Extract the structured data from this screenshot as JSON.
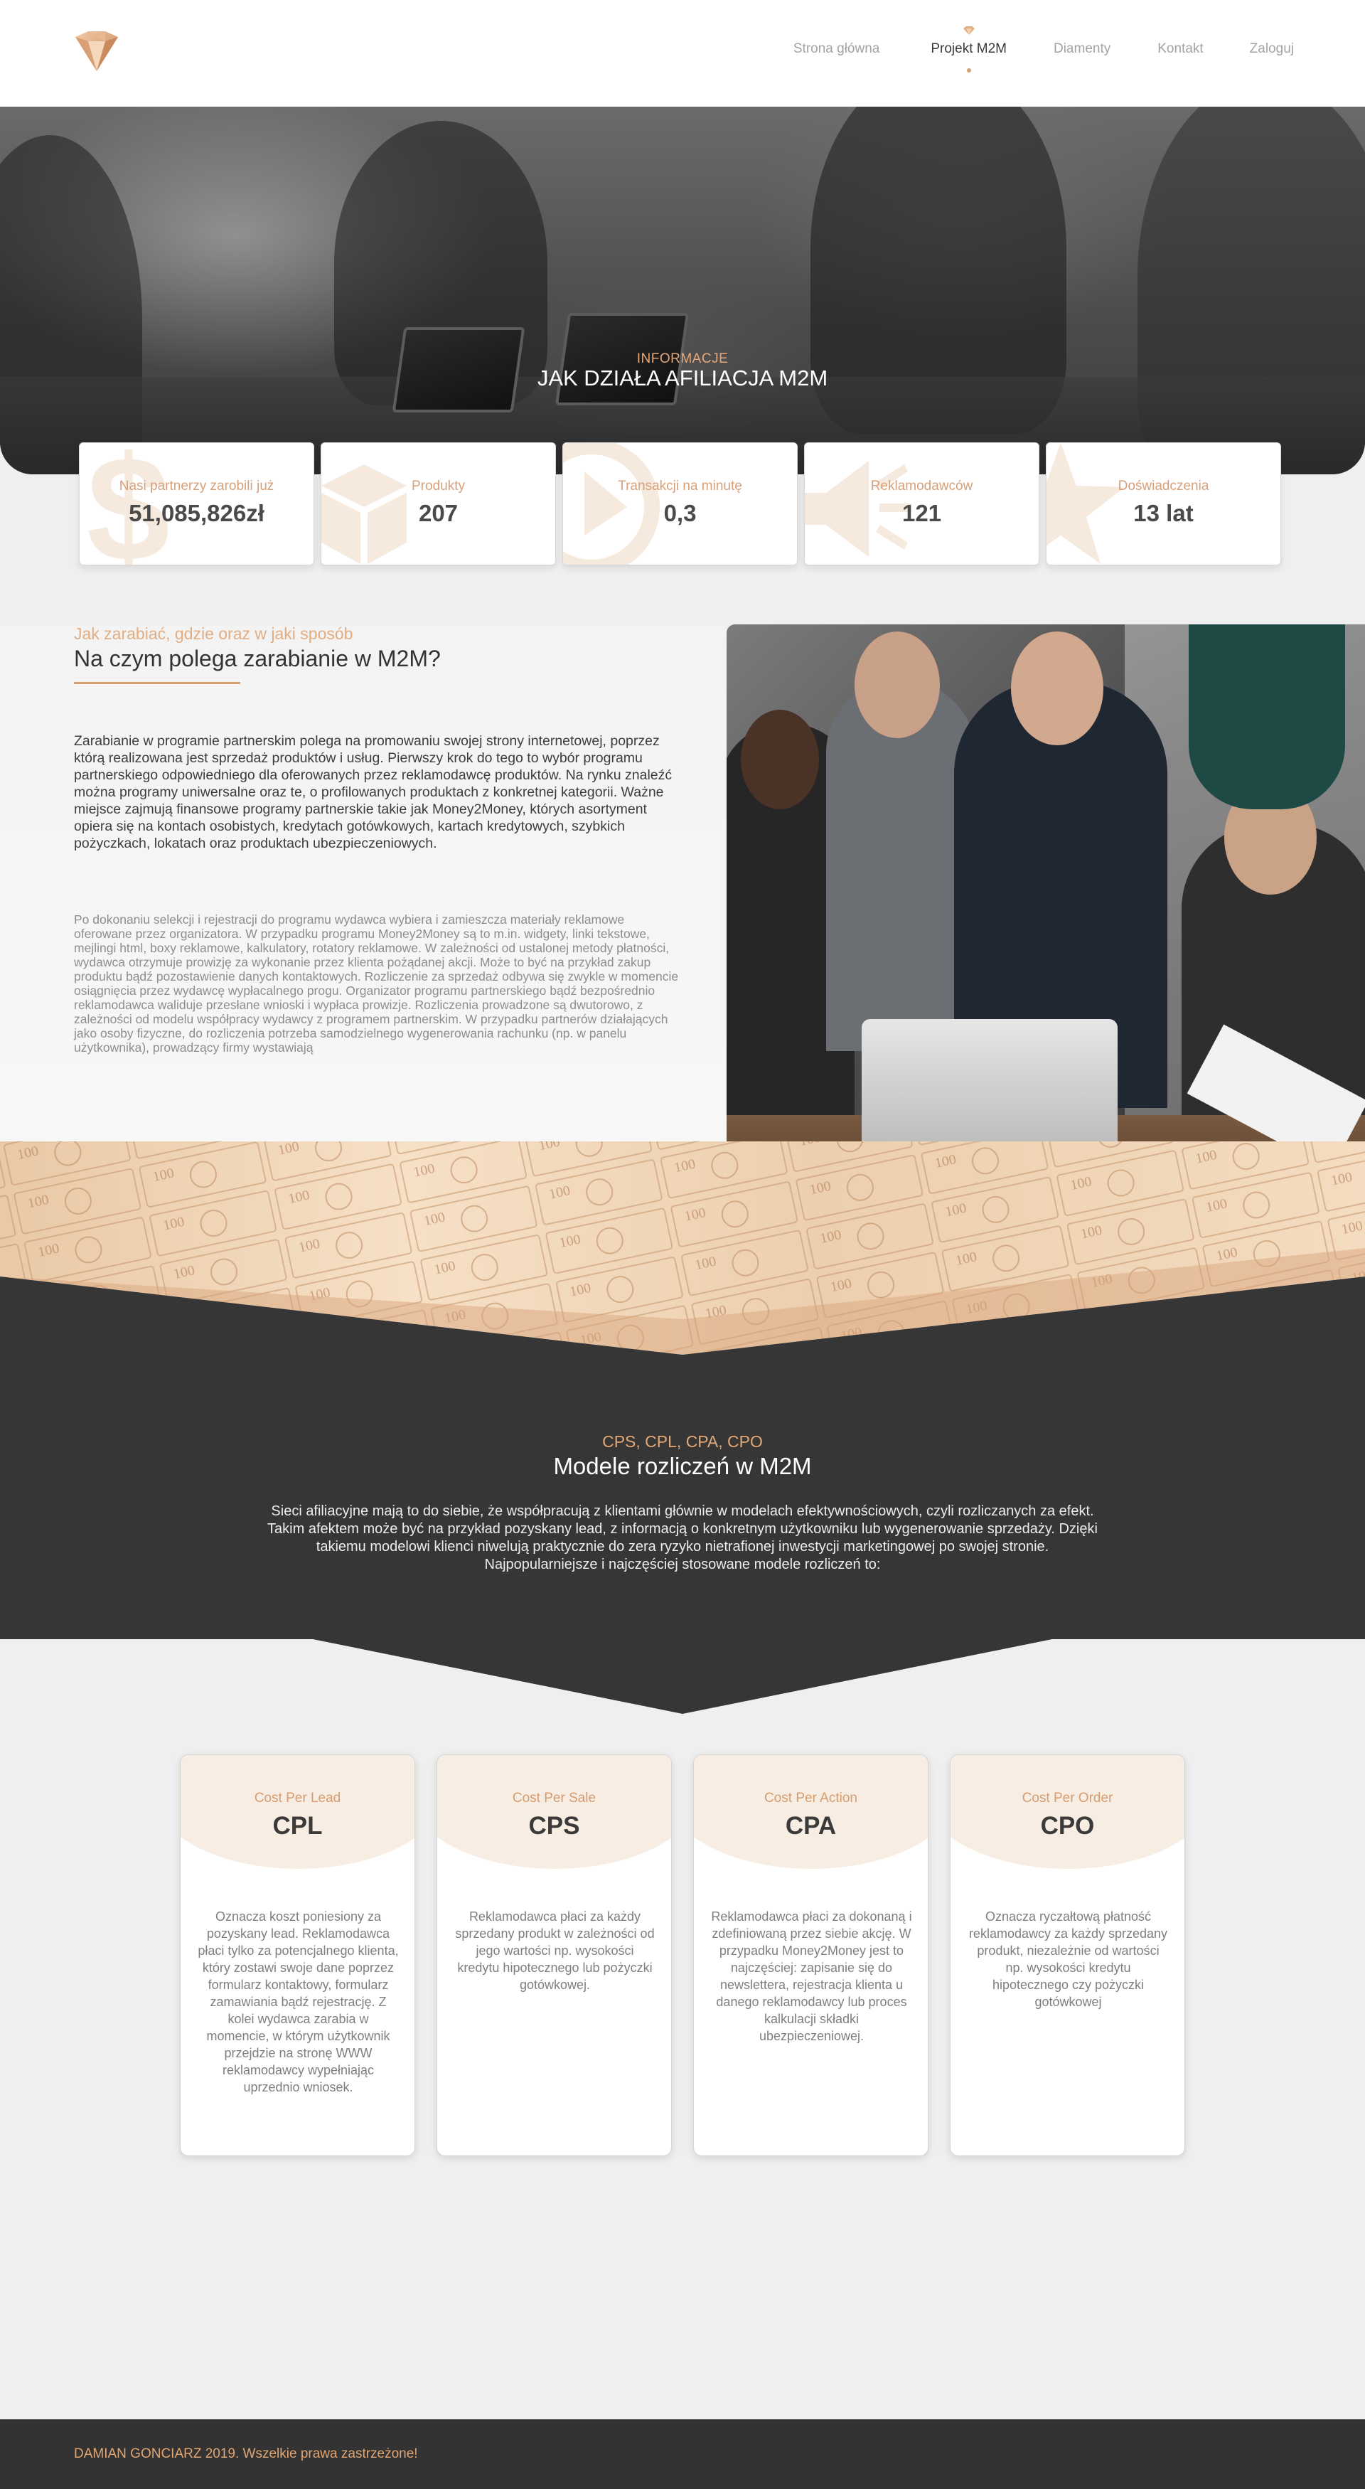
{
  "nav": {
    "items": [
      {
        "label": "Strona główna"
      },
      {
        "label": "Projekt M2M"
      },
      {
        "label": "Diamenty"
      },
      {
        "label": "Kontakt"
      },
      {
        "label": "Zaloguj"
      }
    ],
    "active_index": 1
  },
  "hero": {
    "kicker": "INFORMACJE",
    "title": "JAK DZIAŁA AFILIACJA M2M"
  },
  "stats": [
    {
      "label": "Nasi partnerzy zarobili już",
      "value": "51,085,826zł",
      "icon": "dollar-icon"
    },
    {
      "label": "Produkty",
      "value": "207",
      "icon": "box-icon"
    },
    {
      "label": "Transakcji na minutę",
      "value": "0,3",
      "icon": "clock-icon"
    },
    {
      "label": "Reklamodawców",
      "value": "121",
      "icon": "megaphone-icon"
    },
    {
      "label": "Doświadczenia",
      "value": "13 lat",
      "icon": "star-icon"
    }
  ],
  "about": {
    "kicker": "Jak zarabiać, gdzie oraz w jaki sposób",
    "title": "Na czym polega zarabianie w M2M?",
    "paragraph1": "Zarabianie w programie partnerskim polega na promowaniu swojej strony internetowej, poprzez którą realizowana jest sprzedaż produktów i usług. Pierwszy krok do tego to wybór programu partnerskiego odpowiedniego dla oferowanych przez reklamodawcę produktów. Na rynku znaleźć można programy uniwersalne oraz te, o profilowanych produktach z konkretnej kategorii. Ważne miejsce zajmują finansowe programy partnerskie takie jak Money2Money, których asortyment opiera się na kontach osobistych, kredytach gotówkowych, kartach kredytowych, szybkich pożyczkach, lokatach oraz produktach ubezpieczeniowych.",
    "paragraph2": "Po dokonaniu selekcji i rejestracji do programu wydawca wybiera i zamieszcza materiały reklamowe oferowane przez organizatora. W przypadku programu Money2Money są to m.in. widgety, linki tekstowe, mejlingi html, boxy reklamowe, kalkulatory, rotatory reklamowe. W zależności od ustalonej metody płatności, wydawca otrzymuje prowizję za wykonanie przez klienta pożądanej akcji. Może to być na przykład zakup produktu bądź pozostawienie danych kontaktowych. Rozliczenie za sprzedaż odbywa się zwykle w momencie osiągnięcia przez wydawcę wypłacalnego progu. Organizator programu partnerskiego bądź bezpośrednio reklamodawca waliduje przesłane wnioski i wypłaca prowizje. Rozliczenia prowadzone są dwutorowo, z zależności od modelu współpracy wydawcy z programem partnerskim. W przypadku partnerów działających jako osoby fizyczne, do rozliczenia potrzeba samodzielnego wygenerowania rachunku (np. w panelu użytkownika), prowadzący firmy wystawiają"
  },
  "models_section": {
    "kicker": "CPS, CPL, CPA, CPO",
    "title": "Modele rozliczeń w M2M",
    "description": "Sieci afiliacyjne mają to do siebie, że współpracują z klientami głównie w modelach efektywnościowych, czyli rozliczanych za efekt. Takim afektem może być na przykład pozyskany lead, z informacją o konkretnym użytkowniku lub wygenerowanie sprzedaży. Dzięki takiemu modelowi klienci niwelują praktycznie do zera ryzyko nietrafionej inwestycji marketingowej po swojej stronie. Najpopularniejsze i najczęściej stosowane modele rozliczeń to:"
  },
  "models": [
    {
      "subtitle": "Cost Per Lead",
      "abbr": "CPL",
      "text": "Oznacza koszt poniesiony za pozyskany lead. Reklamodawca płaci tylko za potencjalnego klienta, który zostawi swoje dane poprzez formularz kontaktowy, formularz zamawiania bądź rejestrację. Z kolei wydawca zarabia w momencie, w którym użytkownik przejdzie na stronę WWW reklamodawcy wypełniając uprzednio wniosek."
    },
    {
      "subtitle": "Cost Per Sale",
      "abbr": "CPS",
      "text": "Reklamodawca płaci za każdy sprzedany produkt w zależności od jego wartości np. wysokości kredytu hipotecznego lub pożyczki gotówkowej."
    },
    {
      "subtitle": "Cost Per Action",
      "abbr": "CPA",
      "text": "Reklamodawca płaci za dokonaną i zdefiniowaną przez siebie akcję. W przypadku Money2Money jest to najczęściej: zapisanie się do newslettera, rejestracja klienta u danego reklamodawcy lub proces kalkulacji składki ubezpieczeniowej."
    },
    {
      "subtitle": "Cost Per Order",
      "abbr": "CPO",
      "text": "Oznacza ryczałtową płatność reklamodawcy za każdy sprzedany produkt, niezależnie od wartości np. wysokości kredytu hipotecznego czy pożyczki gotówkowej"
    }
  ],
  "footer": {
    "text": "DAMIAN GONCIARZ 2019. Wszelkie prawa zastrzeżone!"
  },
  "colors": {
    "accent": "#d9a06f",
    "dark": "#333333",
    "background": "#efefef"
  }
}
